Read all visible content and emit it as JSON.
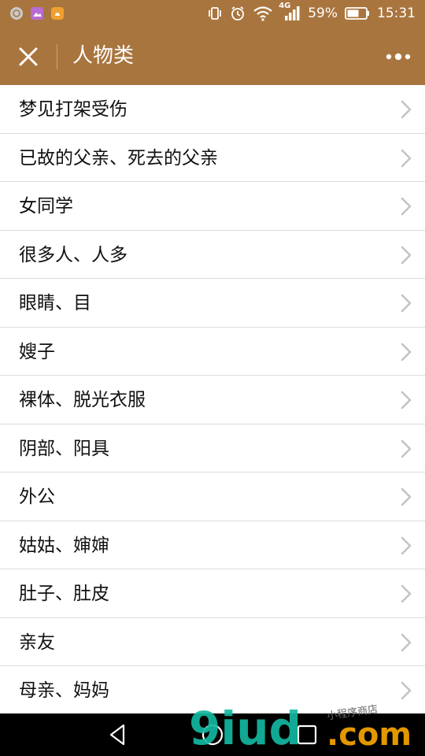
{
  "status_bar": {
    "network": "4G",
    "battery": "59%",
    "time": "15:31",
    "icons": [
      "app-icon-gray",
      "app-icon-purple-gallery",
      "app-icon-orange",
      "vibrate-icon",
      "alarm-icon",
      "wifi-icon",
      "signal-icon",
      "battery-icon"
    ],
    "colors": {
      "app_gray": "#c9c9c9",
      "app_purple": "#b86bd0",
      "app_orange": "#f0a030"
    }
  },
  "header": {
    "title": "人物类",
    "background": "#a9753e"
  },
  "list": {
    "items": [
      {
        "label": "梦见打架受伤"
      },
      {
        "label": "已故的父亲、死去的父亲"
      },
      {
        "label": "女同学"
      },
      {
        "label": "很多人、人多"
      },
      {
        "label": "眼睛、目"
      },
      {
        "label": "嫂子"
      },
      {
        "label": "裸体、脱光衣服"
      },
      {
        "label": "阴部、阳具"
      },
      {
        "label": "外公"
      },
      {
        "label": "姑姑、婶婶"
      },
      {
        "label": "肚子、肚皮"
      },
      {
        "label": "亲友"
      },
      {
        "label": "母亲、妈妈"
      }
    ]
  },
  "watermark": {
    "brand": "9iud",
    "suffix": ".com",
    "small_text": "小程序商店",
    "colors": {
      "brand": "#13b8a0",
      "suffix": "#f0a000"
    }
  }
}
